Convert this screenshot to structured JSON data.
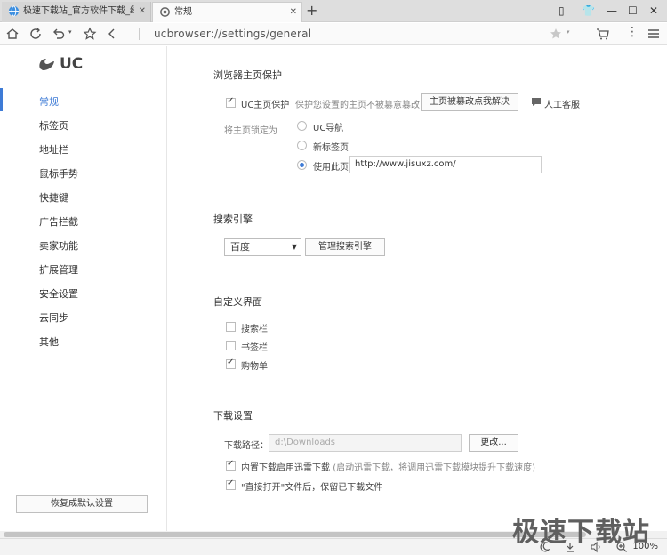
{
  "tabs": [
    {
      "title": "极速下载站_官方软件下载_绿色",
      "active": false
    },
    {
      "title": "常规",
      "active": true
    }
  ],
  "toolbar": {
    "url": "ucbrowser://settings/general"
  },
  "sidebar": {
    "logo_text": "UC",
    "items": [
      {
        "label": "常规",
        "active": true
      },
      {
        "label": "标签页"
      },
      {
        "label": "地址栏"
      },
      {
        "label": "鼠标手势"
      },
      {
        "label": "快捷键"
      },
      {
        "label": "广告拦截"
      },
      {
        "label": "卖家功能"
      },
      {
        "label": "扩展管理"
      },
      {
        "label": "安全设置"
      },
      {
        "label": "云同步"
      },
      {
        "label": "其他"
      }
    ],
    "reset_label": "恢复成默认设置"
  },
  "homepage": {
    "title": "浏览器主页保护",
    "protect_label": "UC主页保护",
    "protect_checked": true,
    "protect_desc": "保护您设置的主页不被篡意篡改",
    "fix_button": "主页被篡改点我解决",
    "support_label": "人工客服",
    "lock_label": "将主页锁定为",
    "options": [
      {
        "label": "UC导航",
        "checked": false
      },
      {
        "label": "新标签页",
        "checked": false
      },
      {
        "label": "使用此页",
        "checked": true
      }
    ],
    "custom_url": "http://www.jisuxz.com/"
  },
  "search": {
    "title": "搜索引擎",
    "selected": "百度",
    "manage_button": "管理搜索引擎"
  },
  "ui": {
    "title": "自定义界面",
    "items": [
      {
        "label": "搜索栏",
        "checked": false
      },
      {
        "label": "书签栏",
        "checked": false
      },
      {
        "label": "购物单",
        "checked": true
      }
    ]
  },
  "download": {
    "title": "下载设置",
    "path_label": "下载路径：",
    "path_value": "d:\\Downloads",
    "change_button": "更改...",
    "thunder_label": "内置下载启用迅雷下载",
    "thunder_hint": "(启动迅雷下载，将调用迅雷下载模块提升下载速度)",
    "thunder_checked": true,
    "keep_label": "\"直接打开\"文件后，保留已下载文件",
    "keep_checked": true
  },
  "statusbar": {
    "zoom": "100%"
  },
  "watermark": "极速下载站",
  "colors": {
    "accent": "#3e7bd6"
  }
}
